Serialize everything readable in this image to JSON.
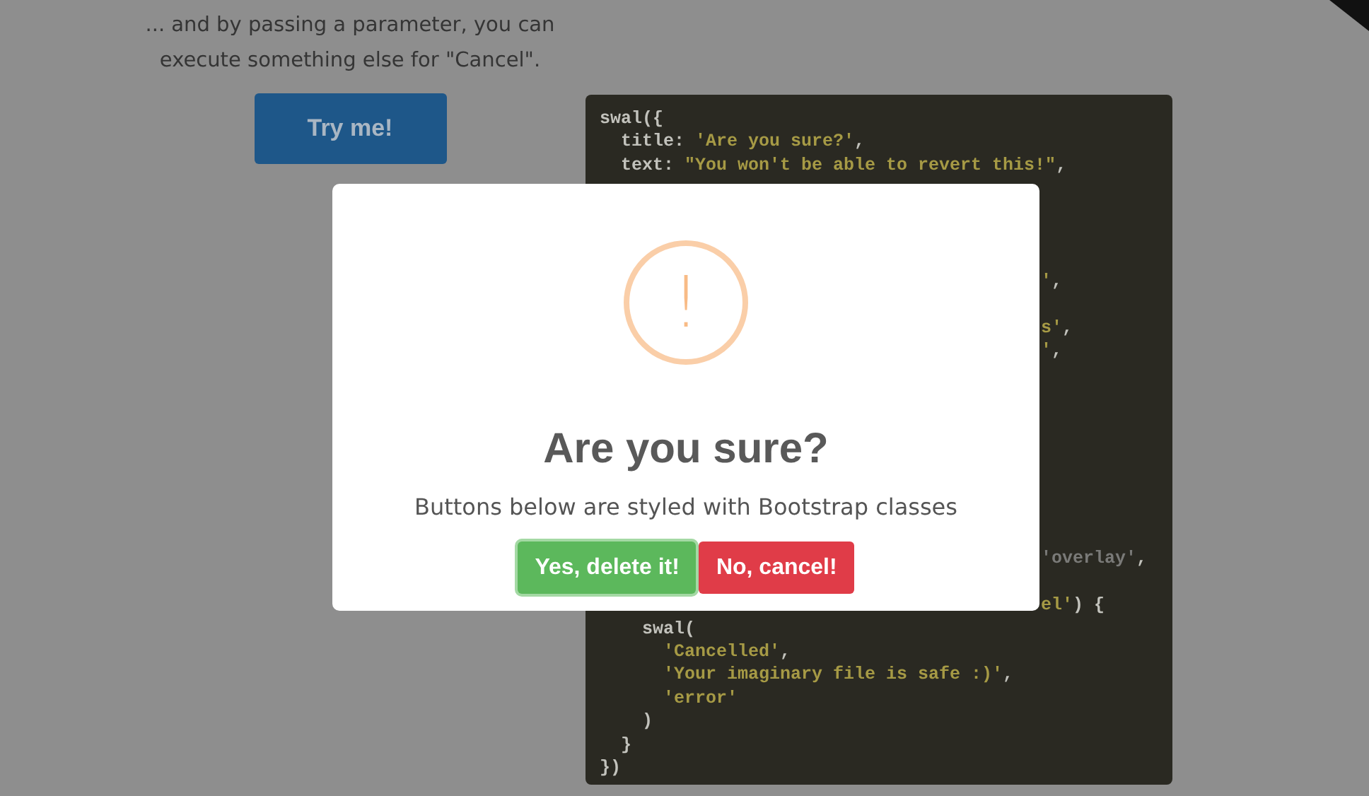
{
  "intro": {
    "text": "... and by passing a parameter, you can execute something else for \"Cancel\".",
    "button": "Try me!"
  },
  "code_block": {
    "lines": [
      {
        "kind": "full",
        "parts": [
          {
            "kind": "plain",
            "text": "swal({"
          }
        ]
      },
      {
        "kind": "full",
        "parts": [
          {
            "kind": "plain",
            "text": "  title: "
          },
          {
            "kind": "string",
            "text": "'Are you sure?'"
          },
          {
            "kind": "plain",
            "text": ","
          }
        ]
      },
      {
        "kind": "full",
        "parts": [
          {
            "kind": "plain",
            "text": "  text: "
          },
          {
            "kind": "string",
            "text": "\"You won't be able to revert this!\""
          },
          {
            "kind": "plain",
            "text": ","
          }
        ]
      },
      {
        "kind": "covered"
      },
      {
        "kind": "covered"
      },
      {
        "kind": "covered"
      },
      {
        "kind": "covered"
      },
      {
        "kind": "tail",
        "parts": [
          {
            "kind": "string",
            "text": "'"
          },
          {
            "kind": "plain",
            "text": ","
          }
        ]
      },
      {
        "kind": "covered"
      },
      {
        "kind": "tail",
        "parts": [
          {
            "kind": "string",
            "text": "s'"
          },
          {
            "kind": "plain",
            "text": ","
          }
        ]
      },
      {
        "kind": "tail",
        "parts": [
          {
            "kind": "string",
            "text": "'"
          },
          {
            "kind": "plain",
            "text": ","
          }
        ]
      },
      {
        "kind": "covered"
      },
      {
        "kind": "covered"
      },
      {
        "kind": "covered"
      },
      {
        "kind": "covered"
      },
      {
        "kind": "covered"
      },
      {
        "kind": "covered"
      },
      {
        "kind": "covered"
      },
      {
        "kind": "covered"
      },
      {
        "kind": "tail",
        "parts": [
          {
            "kind": "comment",
            "text": "'overlay'"
          },
          {
            "kind": "plain",
            "text": ","
          }
        ]
      },
      {
        "kind": "covered"
      },
      {
        "kind": "tail",
        "parts": [
          {
            "kind": "string",
            "text": "el'"
          },
          {
            "kind": "plain",
            "text": ") {"
          }
        ]
      },
      {
        "kind": "full",
        "parts": [
          {
            "kind": "plain",
            "text": "    swal("
          }
        ]
      },
      {
        "kind": "full",
        "parts": [
          {
            "kind": "string",
            "text": "      'Cancelled'"
          },
          {
            "kind": "plain",
            "text": ","
          }
        ]
      },
      {
        "kind": "full",
        "parts": [
          {
            "kind": "string",
            "text": "      'Your imaginary file is safe :)'"
          },
          {
            "kind": "plain",
            "text": ","
          }
        ]
      },
      {
        "kind": "full",
        "parts": [
          {
            "kind": "string",
            "text": "      'error'"
          }
        ]
      },
      {
        "kind": "full",
        "parts": [
          {
            "kind": "plain",
            "text": "    )"
          }
        ]
      },
      {
        "kind": "full",
        "parts": [
          {
            "kind": "plain",
            "text": "  }"
          }
        ]
      },
      {
        "kind": "full",
        "parts": [
          {
            "kind": "plain",
            "text": "})"
          }
        ]
      }
    ]
  },
  "dialog": {
    "icon": "!",
    "title": "Are you sure?",
    "text": "Buttons below are styled with Bootstrap classes",
    "buttons": [
      {
        "label": "Yes, delete it!",
        "kind": "confirm",
        "focused": true
      },
      {
        "label": "No, cancel!",
        "kind": "cancel",
        "focused": false
      }
    ]
  }
}
